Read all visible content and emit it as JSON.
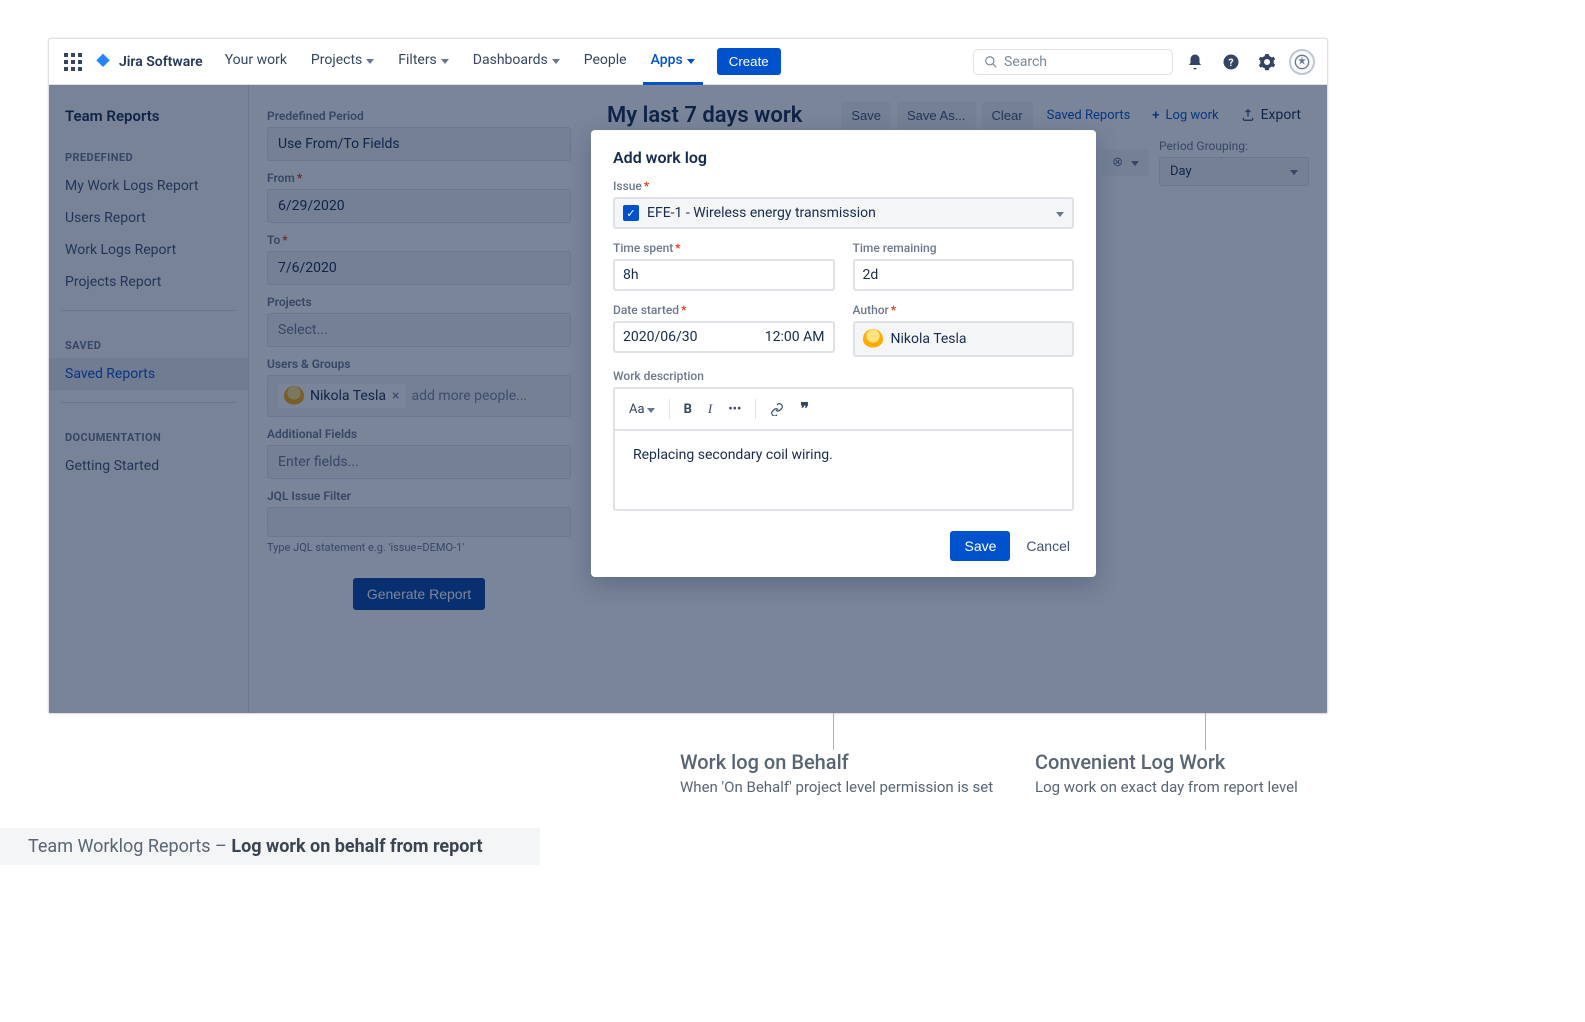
{
  "nav": {
    "product": "Jira Software",
    "items": [
      "Your work",
      "Projects",
      "Filters",
      "Dashboards",
      "People",
      "Apps"
    ],
    "create": "Create",
    "search_placeholder": "Search"
  },
  "sidebar": {
    "title": "Team Reports",
    "section_predefined": "PREDEFINED",
    "section_saved": "SAVED",
    "section_docs": "DOCUMENTATION",
    "predefined": [
      "My Work Logs Report",
      "Users Report",
      "Work Logs Report",
      "Projects Report"
    ],
    "saved": [
      "Saved Reports"
    ],
    "docs": [
      "Getting Started"
    ]
  },
  "filters": {
    "predefined_period_label": "Predefined Period",
    "predefined_period_value": "Use From/To Fields",
    "from_label": "From",
    "from_value": "6/29/2020",
    "to_label": "To",
    "to_value": "7/6/2020",
    "projects_label": "Projects",
    "projects_placeholder": "Select...",
    "users_label": "Users & Groups",
    "user_chip": "Nikola Tesla",
    "users_placeholder": "add more people...",
    "addfields_label": "Additional Fields",
    "addfields_placeholder": "Enter fields...",
    "jql_label": "JQL Issue Filter",
    "jql_hint": "Type JQL statement e.g. 'issue=DEMO-1'",
    "generate": "Generate Report"
  },
  "report": {
    "title": "My last 7 days work",
    "save": "Save",
    "saveas": "Save As...",
    "clear": "Clear",
    "saved_reports": "Saved Reports",
    "log_work": "Log work",
    "export": "Export",
    "period_grouping_label": "Period Grouping:",
    "period_grouping_value": "Day"
  },
  "modal": {
    "title": "Add work log",
    "issue_label": "Issue",
    "issue_value": "EFE-1 - Wireless energy transmission",
    "time_spent_label": "Time spent",
    "time_spent_value": "8h",
    "time_remaining_label": "Time remaining",
    "time_remaining_value": "2d",
    "date_started_label": "Date started",
    "date_value": "2020/06/30",
    "time_value": "12:00 AM",
    "author_label": "Author",
    "author_value": "Nikola Tesla",
    "desc_label": "Work description",
    "desc_value": "Replacing secondary coil wiring.",
    "toolbar_text": "Aa",
    "save": "Save",
    "cancel": "Cancel"
  },
  "annotations": {
    "behalf_title": "Work log on Behalf",
    "behalf_sub": "When 'On Behalf' project level permission is set",
    "convenient_title": "Convenient Log Work",
    "convenient_sub": "Log work on exact day from report level",
    "caption_prefix": "Team Worklog Reports – ",
    "caption_bold": "Log work on behalf from report"
  }
}
